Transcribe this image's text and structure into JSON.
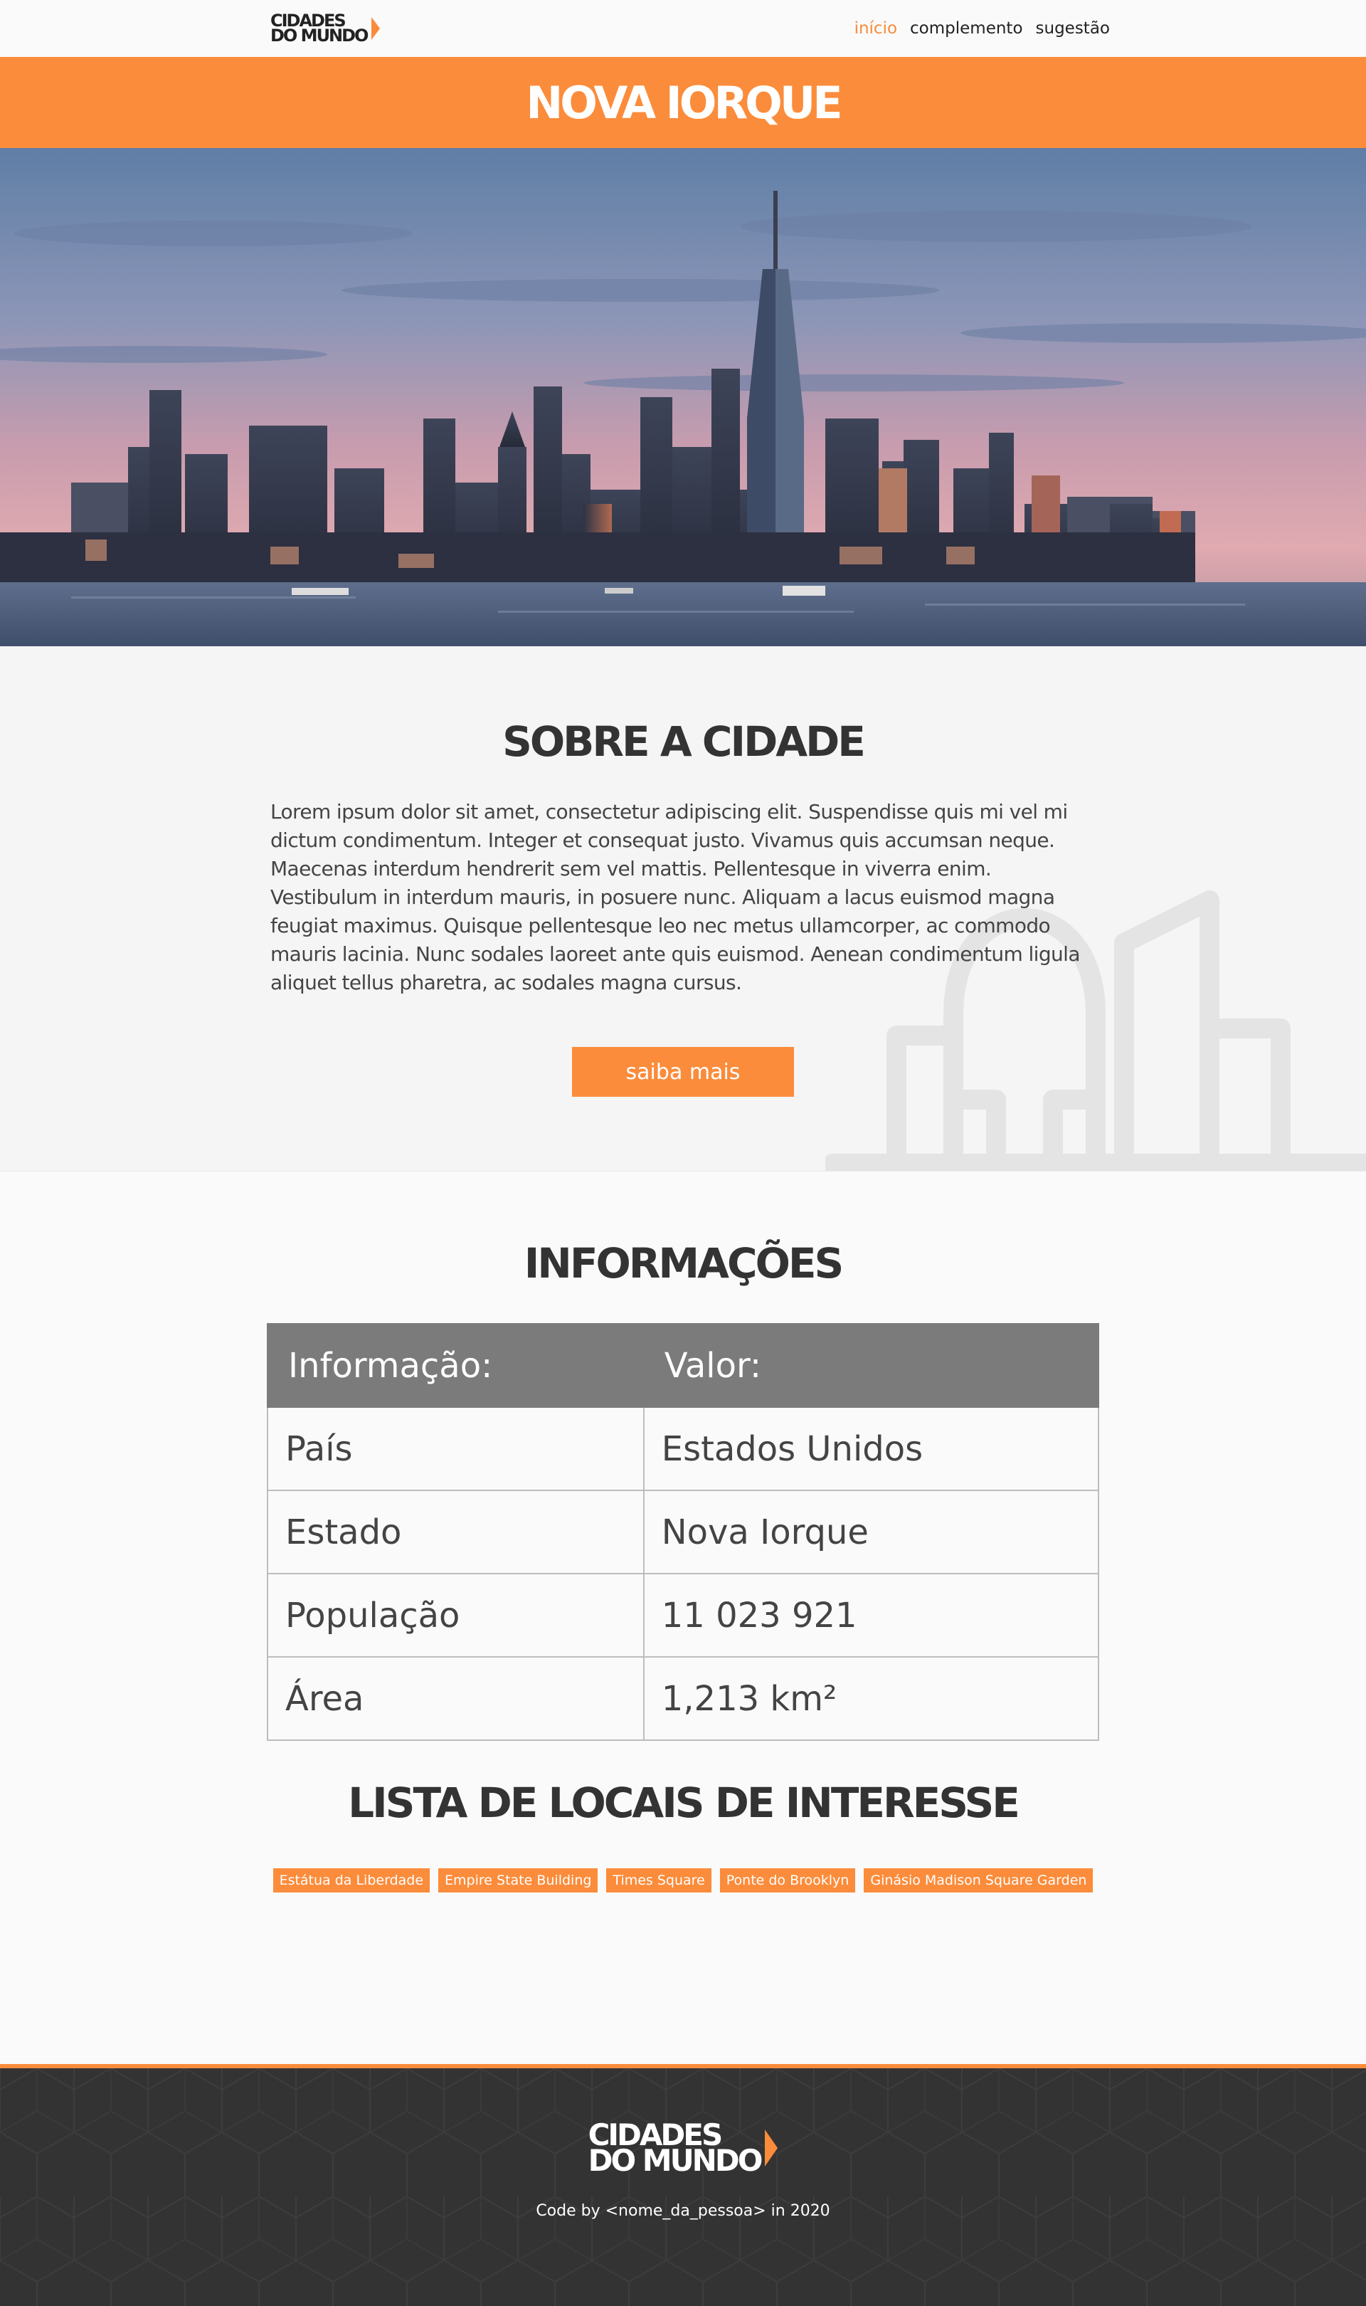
{
  "header": {
    "logo_line1": "CIDADES",
    "logo_line2": "DO MUNDO",
    "nav": [
      {
        "label": "início"
      },
      {
        "label": "complemento"
      },
      {
        "label": "sugestão"
      }
    ]
  },
  "city_title": "NOVA IORQUE",
  "about": {
    "title": "SOBRE A CIDADE",
    "text": "Lorem ipsum dolor sit amet, consectetur adipiscing elit. Suspendisse quis mi vel mi dictum condimentum. Integer et consequat justo. Vivamus quis accumsan neque. Maecenas interdum hendrerit sem vel mattis. Pellentesque in viverra enim. Vestibulum in interdum mauris, in posuere nunc. Aliquam a lacus euismod magna feugiat maximus. Quisque pellentesque leo nec metus ullamcorper, ac commodo mauris lacinia. Nunc sodales laoreet ante quis euismod. Aenean condimentum ligula aliquet tellus pharetra, ac sodales magna cursus.",
    "button": "saiba mais"
  },
  "info": {
    "title": "INFORMAÇÕES",
    "headers": [
      "Informação:",
      "Valor:"
    ],
    "rows": [
      [
        "País",
        "Estados Unidos"
      ],
      [
        "Estado",
        "Nova Iorque"
      ],
      [
        "População",
        "11 023 921"
      ],
      [
        "Área",
        "1,213 km²"
      ]
    ]
  },
  "places": {
    "title": "LISTA DE LOCAIS DE INTERESSE",
    "items": [
      "Estátua da Liberdade",
      "Empire State Building",
      "Times Square",
      "Ponte do Brooklyn",
      "Ginásio Madison Square Garden"
    ]
  },
  "footer": {
    "logo_line1": "CIDADES",
    "logo_line2": "DO MUNDO",
    "credit": "Code by <nome_da_pessoa> in 2020"
  },
  "colors": {
    "accent": "#fb8c3b",
    "dark": "#333333",
    "table_header": "#7b7b7b"
  }
}
